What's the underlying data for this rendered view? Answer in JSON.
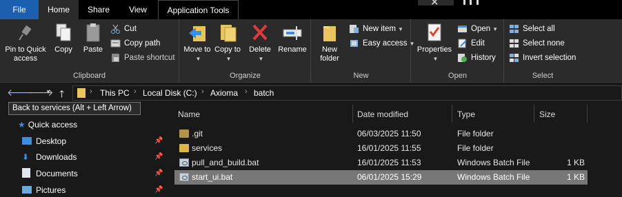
{
  "tabs": {
    "file": "File",
    "home": "Home",
    "share": "Share",
    "view": "View",
    "app_tools": "Application Tools"
  },
  "window": {
    "close_glyph": "✕"
  },
  "ribbon": {
    "clipboard": {
      "label": "Clipboard",
      "pin": "Pin to Quick access",
      "copy": "Copy",
      "paste": "Paste",
      "cut": "Cut",
      "copy_path": "Copy path",
      "paste_shortcut": "Paste shortcut"
    },
    "organize": {
      "label": "Organize",
      "move_to": "Move to",
      "copy_to": "Copy to",
      "delete": "Delete",
      "rename": "Rename"
    },
    "new": {
      "label": "New",
      "new_folder": "New folder",
      "new_item": "New item",
      "easy_access": "Easy access"
    },
    "open": {
      "label": "Open",
      "properties": "Properties",
      "open": "Open",
      "edit": "Edit",
      "history": "History"
    },
    "select": {
      "label": "Select",
      "select_all": "Select all",
      "select_none": "Select none",
      "invert": "Invert selection"
    }
  },
  "address": {
    "crumbs": [
      "This PC",
      "Local Disk (C:)",
      "Axioma",
      "batch"
    ],
    "separator": "›"
  },
  "tooltip": "Back to services (Alt + Left Arrow)",
  "nav": {
    "quick_access": "Quick access",
    "items": [
      "Desktop",
      "Downloads",
      "Documents",
      "Pictures"
    ]
  },
  "columns": {
    "name": "Name",
    "date": "Date modified",
    "type": "Type",
    "size": "Size"
  },
  "files": [
    {
      "name": ".git",
      "date": "06/03/2025 11:50",
      "type": "File folder",
      "size": "",
      "icon": "folder-icon"
    },
    {
      "name": "services",
      "date": "16/01/2025 11:55",
      "type": "File folder",
      "size": "",
      "icon": "folder-icon"
    },
    {
      "name": "pull_and_build.bat",
      "date": "16/01/2025 11:53",
      "type": "Windows Batch File",
      "size": "1 KB",
      "icon": "batch-file-icon"
    },
    {
      "name": "start_ui.bat",
      "date": "06/01/2025 15:29",
      "type": "Windows Batch File",
      "size": "1 KB",
      "icon": "batch-file-icon",
      "selected": true
    }
  ],
  "colors": {
    "file_tab": "#1c5fae",
    "selection": "#777777",
    "ribbon": "#2b2b2b",
    "background": "#191919"
  }
}
